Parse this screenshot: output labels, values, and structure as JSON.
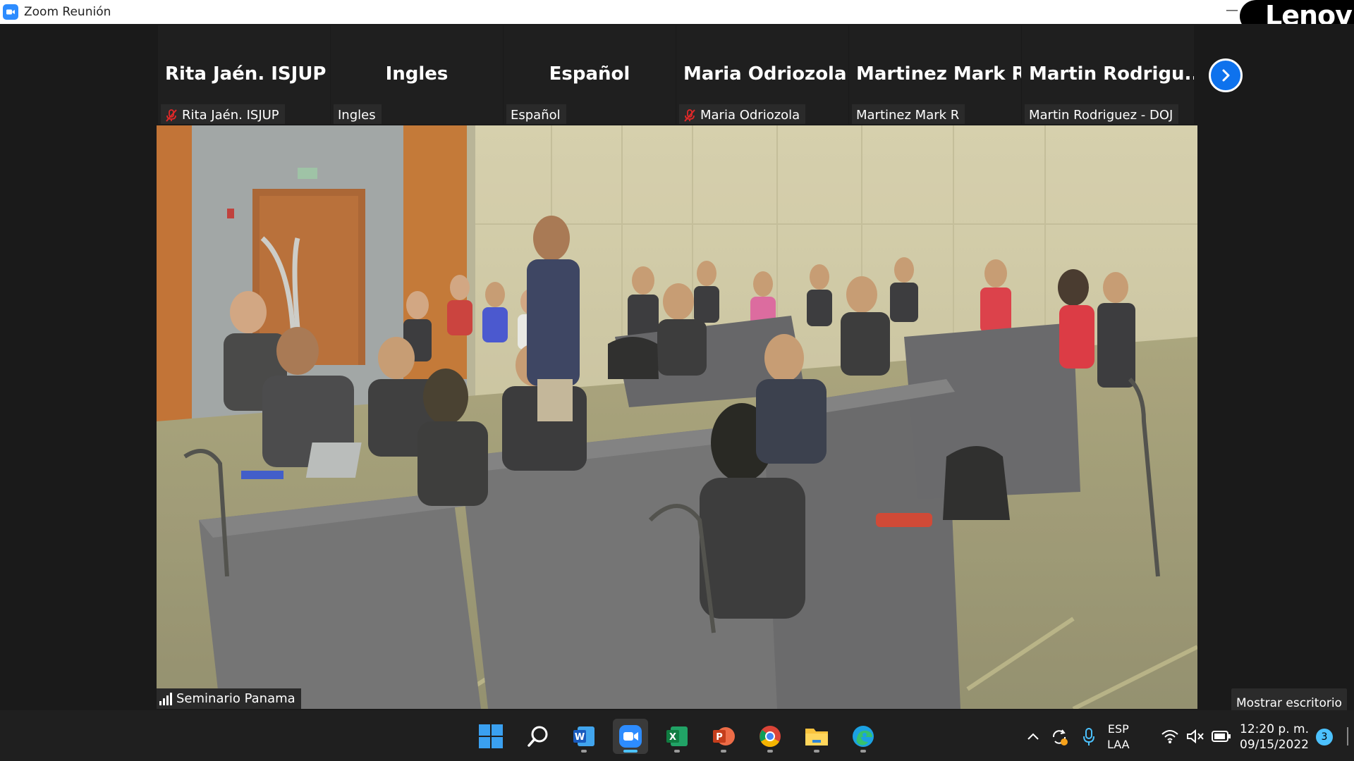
{
  "window": {
    "title": "Zoom Reunión",
    "brand_badge": "Lenov",
    "minimize_glyph": "—"
  },
  "gallery": {
    "tiles": [
      {
        "display_name": "Rita Jaén. ISJUP",
        "label": "Rita Jaén. ISJUP",
        "muted": true
      },
      {
        "display_name": "Ingles",
        "label": "Ingles",
        "muted": false
      },
      {
        "display_name": "Español",
        "label": "Español",
        "muted": false
      },
      {
        "display_name": "Maria Odriozola",
        "label": "Maria Odriozola",
        "muted": true
      },
      {
        "display_name": "Martinez Mark R",
        "label": "Martinez Mark R",
        "muted": false
      },
      {
        "display_name": "Martin  Rodrigu...",
        "label": "Martin Rodriguez - DOJ",
        "muted": false
      }
    ],
    "next_icon": "chevron-right-icon"
  },
  "main_video": {
    "label": "Seminario Panama",
    "signal_icon": "signal-bars-icon"
  },
  "show_desktop_tooltip": "Mostrar escritorio",
  "taskbar": {
    "apps": [
      {
        "name": "windows-start",
        "icon": "windows-logo-icon",
        "active": false
      },
      {
        "name": "search",
        "icon": "search-icon",
        "active": false
      },
      {
        "name": "word",
        "icon": "word-icon",
        "active": false
      },
      {
        "name": "zoom",
        "icon": "zoom-icon",
        "active": true
      },
      {
        "name": "excel",
        "icon": "excel-icon",
        "active": false
      },
      {
        "name": "powerpoint",
        "icon": "powerpoint-icon",
        "active": false
      },
      {
        "name": "chrome",
        "icon": "chrome-icon",
        "active": false
      },
      {
        "name": "file-explorer",
        "icon": "folder-icon",
        "active": false
      },
      {
        "name": "edge",
        "icon": "edge-icon",
        "active": false
      }
    ],
    "tray": {
      "language_line1": "ESP",
      "language_line2": "LAA",
      "time": "12:20 p. m.",
      "date": "09/15/2022",
      "notification_count": "3"
    }
  },
  "colors": {
    "zoom_blue": "#2d8cff",
    "next_button": "#0e72ed",
    "mute_red": "#e02828",
    "taskbar": "#1f1f1f",
    "accent": "#4cc2ff"
  }
}
